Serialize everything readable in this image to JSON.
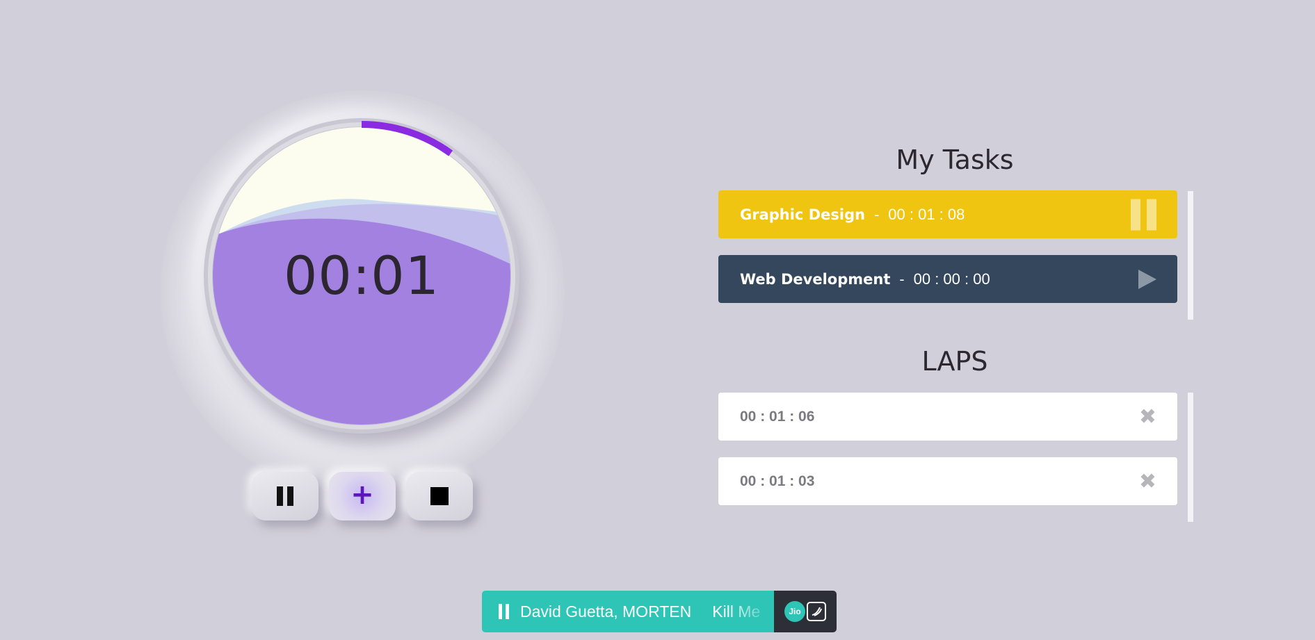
{
  "timer": {
    "display": "00:01",
    "progress_fraction": 0.1,
    "colors": {
      "ring": "#8a2be2",
      "liquid": "#a07fe0",
      "face": "#fcfcef"
    }
  },
  "controls": {
    "pause": {
      "icon": "pause-icon"
    },
    "add": {
      "icon": "plus-icon",
      "glyph": "+"
    },
    "stop": {
      "icon": "stop-icon"
    }
  },
  "tasks": {
    "title": "My Tasks",
    "separator": "-",
    "items": [
      {
        "name": "Graphic Design",
        "time": "00 : 01 : 08",
        "state": "running",
        "action_icon": "pause-icon",
        "color": "#f0c511"
      },
      {
        "name": "Web Development",
        "time": "00 : 00 : 00",
        "state": "stopped",
        "action_icon": "play-icon",
        "color": "#34475c"
      }
    ]
  },
  "laps": {
    "title": "LAPS",
    "items": [
      {
        "time": "00 : 01 : 06",
        "delete_glyph": "✖"
      },
      {
        "time": "00 : 01 : 03",
        "delete_glyph": "✖"
      }
    ]
  },
  "music_player": {
    "artist": "David Guetta, MORTEN",
    "track": "Kill Me",
    "brand": "Jio",
    "color": "#2ec4b6"
  }
}
